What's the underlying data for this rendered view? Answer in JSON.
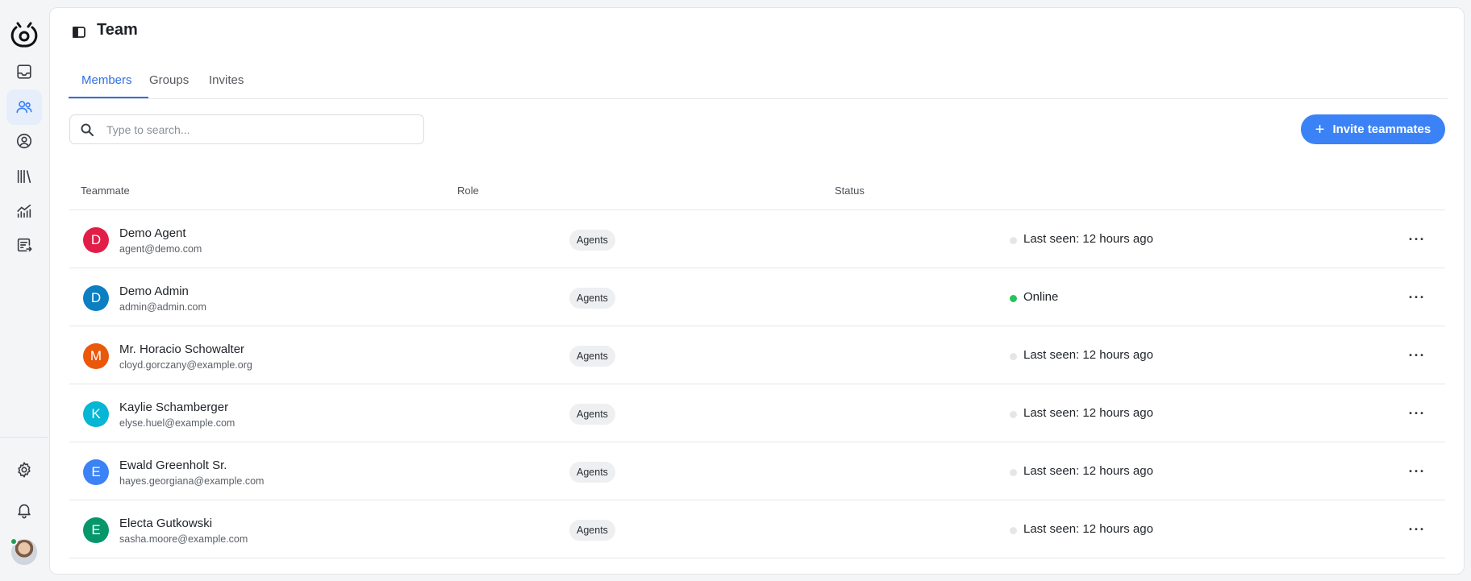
{
  "header": {
    "title": "Team"
  },
  "tabs": [
    {
      "label": "Members",
      "active": true
    },
    {
      "label": "Groups",
      "active": false
    },
    {
      "label": "Invites",
      "active": false
    }
  ],
  "search": {
    "placeholder": "Type to search...",
    "value": ""
  },
  "invite_button": {
    "label": "Invite teammates",
    "icon": "plus-icon"
  },
  "table": {
    "columns": [
      "Teammate",
      "Role",
      "Status"
    ],
    "rows": [
      {
        "initial": "D",
        "color": "#e11d48",
        "name": "Demo Agent",
        "email": "agent@demo.com",
        "role": "Agents",
        "status": "Last seen: 12 hours ago",
        "online": false
      },
      {
        "initial": "D",
        "color": "#0b7fc2",
        "name": "Demo Admin",
        "email": "admin@admin.com",
        "role": "Agents",
        "status": "Online",
        "online": true
      },
      {
        "initial": "M",
        "color": "#ea580c",
        "name": "Mr. Horacio Schowalter",
        "email": "cloyd.gorczany@example.org",
        "role": "Agents",
        "status": "Last seen: 12 hours ago",
        "online": false
      },
      {
        "initial": "K",
        "color": "#06b6d4",
        "name": "Kaylie Schamberger",
        "email": "elyse.huel@example.com",
        "role": "Agents",
        "status": "Last seen: 12 hours ago",
        "online": false
      },
      {
        "initial": "E",
        "color": "#3b82f6",
        "name": "Ewald Greenholt Sr.",
        "email": "hayes.georgiana@example.com",
        "role": "Agents",
        "status": "Last seen: 12 hours ago",
        "online": false
      },
      {
        "initial": "E",
        "color": "#059669",
        "name": "Electa Gutkowski",
        "email": "sasha.moore@example.com",
        "role": "Agents",
        "status": "Last seen: 12 hours ago",
        "online": false
      }
    ]
  },
  "sidebar": {
    "items": [
      {
        "icon": "inbox-icon"
      },
      {
        "icon": "users-icon",
        "active": true
      },
      {
        "icon": "contact-icon"
      },
      {
        "icon": "library-icon"
      },
      {
        "icon": "reports-icon"
      },
      {
        "icon": "campaigns-icon"
      }
    ],
    "bottom": [
      {
        "icon": "gear-icon"
      },
      {
        "icon": "bell-icon"
      }
    ]
  },
  "colors": {
    "accent": "#3b82f6",
    "online": "#22c55e"
  }
}
